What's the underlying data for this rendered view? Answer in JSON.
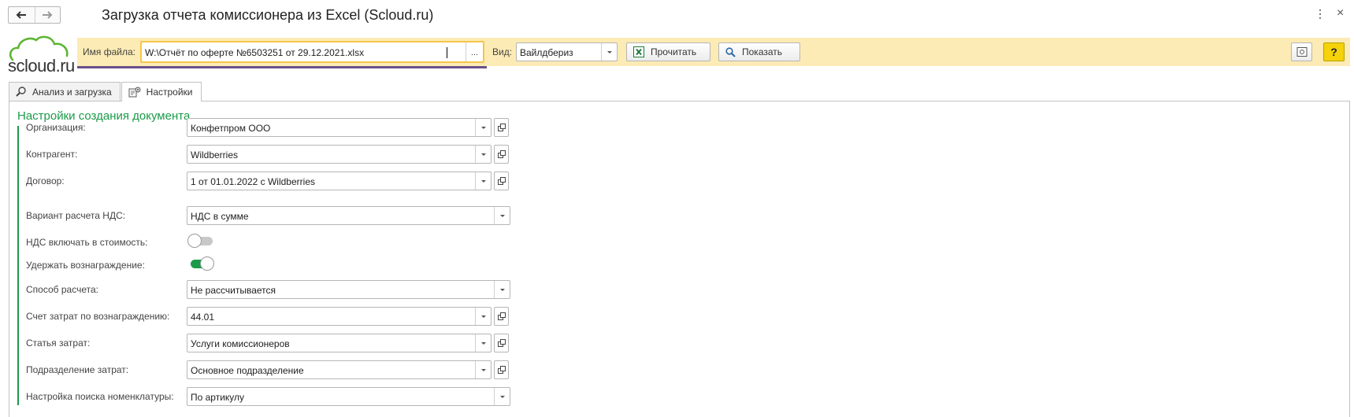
{
  "window": {
    "title": "Загрузка отчета комиссионера из Excel (Scloud.ru)"
  },
  "logo": {
    "text": "scloud.ru"
  },
  "toolbar": {
    "file_label": "Имя файла:",
    "file_value": "W:\\Отчёт по оферте №6503251 от 29.12.2021.xlsx",
    "file_browse": "...",
    "kind_label": "Вид:",
    "kind_value": "Вайлдбериз",
    "read_button": "Прочитать",
    "show_button": "Показать",
    "help_button": "?"
  },
  "tabs": [
    {
      "label": "Анализ и загрузка",
      "icon": "magnifier-icon",
      "active": false
    },
    {
      "label": "Настройки",
      "icon": "settings-icon",
      "active": true
    }
  ],
  "settings": {
    "title": "Настройки создания документа",
    "fields": [
      {
        "label": "Организация:",
        "value": "Конфетпром ООО",
        "kind": "select-open"
      },
      {
        "label": "Контрагент:",
        "value": "Wildberries",
        "kind": "select-open"
      },
      {
        "label": "Договор:",
        "value": "1 от 01.01.2022 с Wildberries",
        "kind": "select-open"
      },
      {
        "label": "Вариант расчета НДС:",
        "value": "НДС в сумме",
        "kind": "select"
      },
      {
        "label": "НДС включать в стоимость:",
        "value": false,
        "kind": "toggle"
      },
      {
        "label": "Удержать вознаграждение:",
        "value": true,
        "kind": "toggle"
      },
      {
        "label": "Способ расчета:",
        "value": "Не рассчитывается",
        "kind": "select"
      },
      {
        "label": "Счет затрат по вознаграждению:",
        "value": "44.01",
        "kind": "select-open"
      },
      {
        "label": "Статья затрат:",
        "value": "Услуги комиссионеров",
        "kind": "select-open"
      },
      {
        "label": "Подразделение затрат:",
        "value": "Основное подразделение",
        "kind": "select-open"
      },
      {
        "label": "Настройка поиска номенклатуры:",
        "value": "По артикулу",
        "kind": "select"
      }
    ]
  },
  "colors": {
    "accent_green": "#1a9b49",
    "toolbar_bg": "#fcebb4",
    "active_input_border": "#f5c64b",
    "help_button": "#f5d20a",
    "toggle_on": "#1a9b49",
    "toggle_off": "#c8c8c8"
  }
}
